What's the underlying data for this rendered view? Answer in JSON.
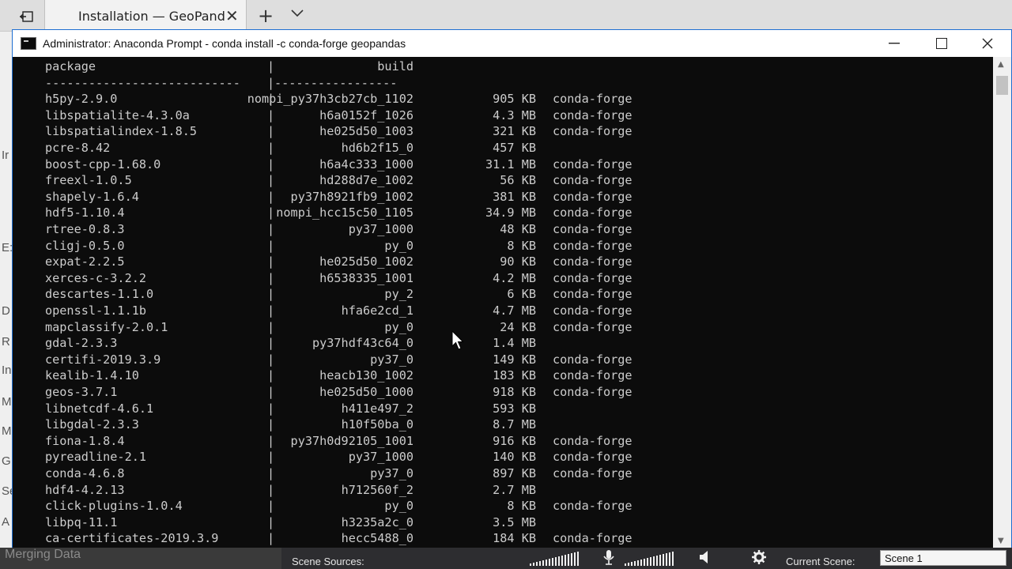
{
  "browser": {
    "tab_title": "Installation — GeoPand",
    "tab_close": "✕",
    "new_tab": "+",
    "tab_list": "﹀"
  },
  "background_page": {
    "letters": [
      "Ir",
      "E:",
      "D",
      "R",
      "In",
      "M",
      "M",
      "G",
      "Se",
      "A"
    ]
  },
  "window": {
    "title": "Administrator: Anaconda Prompt - conda  install -c conda-forge geopandas",
    "minimize": "—",
    "close": "✕"
  },
  "console": {
    "header": {
      "package": "package",
      "build": "build"
    },
    "separator_left": "---------------------------",
    "separator_right": "-----------------",
    "rows": [
      {
        "package": "h5py-2.9.0",
        "build": "nompi_py37h3cb27cb_1102",
        "size": "905 KB",
        "channel": "conda-forge"
      },
      {
        "package": "libspatialite-4.3.0a",
        "build": "h6a0152f_1026",
        "size": "4.3 MB",
        "channel": "conda-forge"
      },
      {
        "package": "libspatialindex-1.8.5",
        "build": "he025d50_1003",
        "size": "321 KB",
        "channel": "conda-forge"
      },
      {
        "package": "pcre-8.42",
        "build": "hd6b2f15_0",
        "size": "457 KB",
        "channel": ""
      },
      {
        "package": "boost-cpp-1.68.0",
        "build": "h6a4c333_1000",
        "size": "31.1 MB",
        "channel": "conda-forge"
      },
      {
        "package": "freexl-1.0.5",
        "build": "hd288d7e_1002",
        "size": "56 KB",
        "channel": "conda-forge"
      },
      {
        "package": "shapely-1.6.4",
        "build": "py37h8921fb9_1002",
        "size": "381 KB",
        "channel": "conda-forge"
      },
      {
        "package": "hdf5-1.10.4",
        "build": "nompi_hcc15c50_1105",
        "size": "34.9 MB",
        "channel": "conda-forge"
      },
      {
        "package": "rtree-0.8.3",
        "build": "py37_1000",
        "size": "48 KB",
        "channel": "conda-forge"
      },
      {
        "package": "cligj-0.5.0",
        "build": "py_0",
        "size": "8 KB",
        "channel": "conda-forge"
      },
      {
        "package": "expat-2.2.5",
        "build": "he025d50_1002",
        "size": "90 KB",
        "channel": "conda-forge"
      },
      {
        "package": "xerces-c-3.2.2",
        "build": "h6538335_1001",
        "size": "4.2 MB",
        "channel": "conda-forge"
      },
      {
        "package": "descartes-1.1.0",
        "build": "py_2",
        "size": "6 KB",
        "channel": "conda-forge"
      },
      {
        "package": "openssl-1.1.1b",
        "build": "hfa6e2cd_1",
        "size": "4.7 MB",
        "channel": "conda-forge"
      },
      {
        "package": "mapclassify-2.0.1",
        "build": "py_0",
        "size": "24 KB",
        "channel": "conda-forge"
      },
      {
        "package": "gdal-2.3.3",
        "build": "py37hdf43c64_0",
        "size": "1.4 MB",
        "channel": ""
      },
      {
        "package": "certifi-2019.3.9",
        "build": "py37_0",
        "size": "149 KB",
        "channel": "conda-forge"
      },
      {
        "package": "kealib-1.4.10",
        "build": "heacb130_1002",
        "size": "183 KB",
        "channel": "conda-forge"
      },
      {
        "package": "geos-3.7.1",
        "build": "he025d50_1000",
        "size": "918 KB",
        "channel": "conda-forge"
      },
      {
        "package": "libnetcdf-4.6.1",
        "build": "h411e497_2",
        "size": "593 KB",
        "channel": ""
      },
      {
        "package": "libgdal-2.3.3",
        "build": "h10f50ba_0",
        "size": "8.7 MB",
        "channel": ""
      },
      {
        "package": "fiona-1.8.4",
        "build": "py37h0d92105_1001",
        "size": "916 KB",
        "channel": "conda-forge"
      },
      {
        "package": "pyreadline-2.1",
        "build": "py37_1000",
        "size": "140 KB",
        "channel": "conda-forge"
      },
      {
        "package": "conda-4.6.8",
        "build": "py37_0",
        "size": "897 KB",
        "channel": "conda-forge"
      },
      {
        "package": "hdf4-4.2.13",
        "build": "h712560f_2",
        "size": "2.7 MB",
        "channel": ""
      },
      {
        "package": "click-plugins-1.0.4",
        "build": "py_0",
        "size": "8 KB",
        "channel": "conda-forge"
      },
      {
        "package": "libpq-11.1",
        "build": "h3235a2c_0",
        "size": "3.5 MB",
        "channel": ""
      },
      {
        "package": "ca-certificates-2019.3.9",
        "build": "hecc5488_0",
        "size": "184 KB",
        "channel": "conda-forge"
      }
    ]
  },
  "obs": {
    "merging": "Merging Data",
    "scene_sources_label": "Scene Sources:",
    "current_scene_label": "Current Scene:",
    "current_scene_value": "Scene 1"
  },
  "colors": {
    "console_bg": "#0c0c0c",
    "console_text": "#cccccc",
    "window_border": "#1f6fd1"
  }
}
